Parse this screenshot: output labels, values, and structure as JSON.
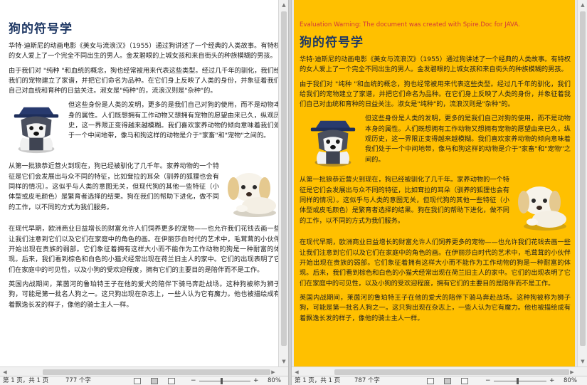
{
  "document": {
    "title": "狗的符号学",
    "paragraphs": [
      "华特·迪斯尼的动画电影《美女与流浪汉》（1955）通过狗讲述了一个经典的人类故事。有特权的女人爱上了一个完全不同出生的男人。金发碧眼的上城女孩和来自街头的种族模糊的男孩。",
      "由于我们对 \"纯种 \"和血统的概念，狗也经常被用来代表这些类型。经过几千年的驯化，我们给我们的宠物建立了家谱，并把它们命名为品种。在它们身上反映了人类的身份，并象征着我们自己对血统和育种的日益关注。淑女是\"纯种\"的，流浪汉则是\"杂种\"的。",
      "但这些身份是人类的发明，更多的是我们自己对狗的使用，而不是动物本身的属性。人们既想拥有工作动物又想拥有宠物的愿望由来已久，纵观历史，这一界限正变得越来越模糊。我们喜欢家养动物的倾向意味着我们处于一个中间地带，像马和狗这样的动物是介于\"家畜\"和\"宠物\"之间的。",
      "从第一批狼恭近营火到现在，狗已经被驯化了几千年。家养动物的一个特征是它们会发展出与众不同的特征，比如耷拉的耳朵（驯养的狐狸也会有同样的情况）。这似乎与人类的意图无关，但现代狗的其他一些特征（小体型或皮毛颜色）是繁育者选择的结果。狗在我们的帮助下进化，做不同的工作，以不同的方式为我们服务。",
      "在现代早期，欧洲商业日益增长的财富允许人们饲养更多的宠物——也允许我们花钱去画一些让我们注意到它们以及它们在家庭中的角色的画。在伊丽莎白时代的艺术中，毛茸茸的小伙伴开始出现在贵族的弱部。它们象征着拥有这样大小而不能作为工作动物的狗是一种耐富的体现。后来，我们看到棕色和白色的小猫犬经常出现在荷兰旧主人的家中。它们的出现表明了它们在家庭中的可见性，以及小狗的受欢迎程度，拥有它们的主要目的是陪伴而不是工作。",
      "英国内战期间，莱茵河的鲁珀特王子在他的爱犬的陪伴下骑马奔赴战场。这种狗被称为狮子狗，可能是第一批名人狗之一。这只狗出现在杂志上，一些人认为它有魔力。他也被描绘成有着飘逸长发的样子，像他的骑士主人一样。"
    ]
  },
  "left_pane": {
    "status": {
      "page": "第 1 页，共 1 页",
      "words": "777 个字",
      "zoom": "80%"
    }
  },
  "right_pane": {
    "warning": "Evaluation Warning: The document was created with Spire.Doc for JAVA.",
    "status": {
      "page": "第 1 页，共 1 页",
      "words": "787 个字",
      "zoom": "80%"
    }
  },
  "colors": {
    "title": "#1f3864",
    "warning": "#d23939",
    "right_page_background": "#ffc000"
  },
  "icons": {
    "husky": "husky-dog-icon",
    "puppy": "white-puppy-icon"
  }
}
